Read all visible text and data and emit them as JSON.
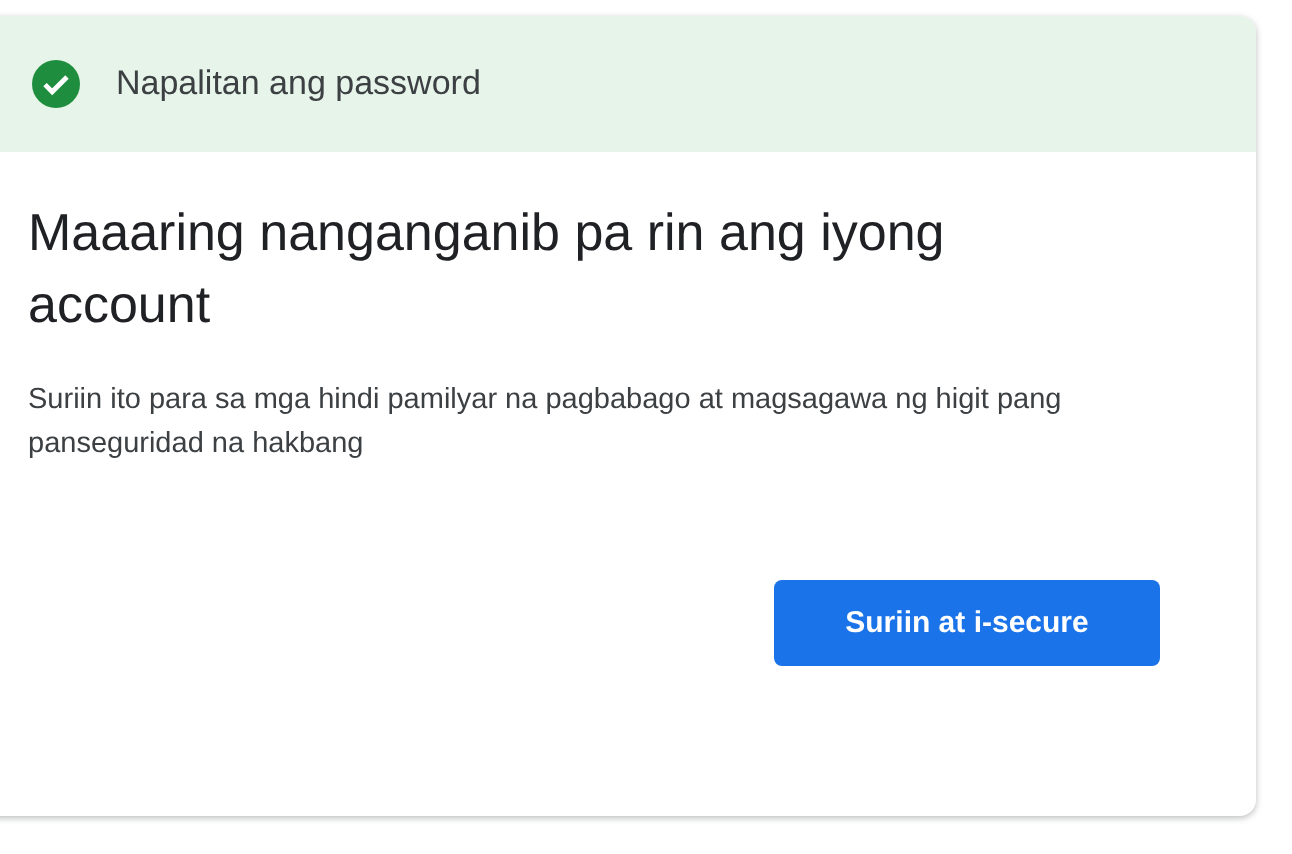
{
  "banner": {
    "text": "Napalitan ang password",
    "kind": "success"
  },
  "title": "Maaaring nanganganib pa rin ang iyong account",
  "description": "Suriin ito para sa mga hindi pamilyar na pagbabago at magsagawa ng higit pang panseguridad na hakbang",
  "button": "Suriin at i-secure"
}
